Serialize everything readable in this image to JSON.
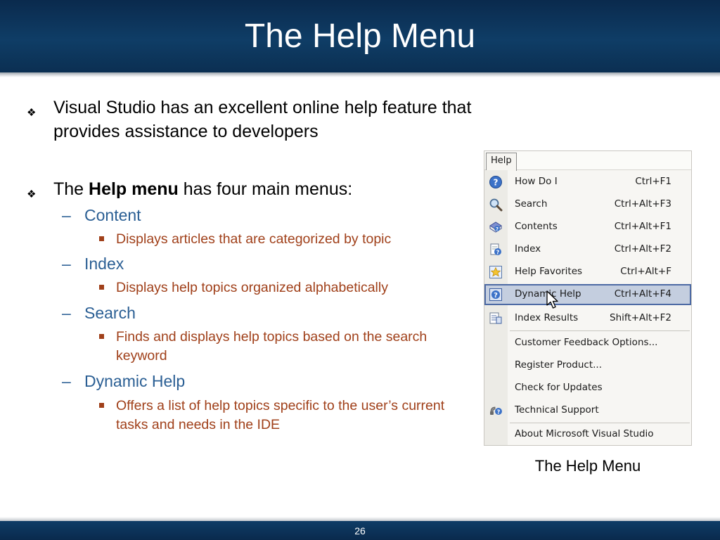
{
  "slide": {
    "title": "The Help Menu",
    "page_number": "26"
  },
  "bullets": {
    "b1_text": "Visual Studio has an excellent online help feature that provides assistance to developers",
    "b2_pre": "The ",
    "b2_bold": "Help menu",
    "b2_post": " has four main menus:",
    "sub": [
      {
        "label": "Content",
        "detail": "Displays articles that are categorized by topic"
      },
      {
        "label": "Index",
        "detail": "Displays help topics organized alphabetically"
      },
      {
        "label": "Search",
        "detail": "Finds and displays help topics based on the search keyword"
      },
      {
        "label": "Dynamic Help",
        "detail": "Offers a list of help topics specific to the user’s current tasks and needs in the IDE"
      }
    ]
  },
  "menu": {
    "tab_label": "Help",
    "items": [
      {
        "label": "How Do I",
        "shortcut": "Ctrl+F1",
        "icon": "question-circle-icon"
      },
      {
        "label": "Search",
        "shortcut": "Ctrl+Alt+F3",
        "icon": "magnifier-icon"
      },
      {
        "label": "Contents",
        "shortcut": "Ctrl+Alt+F1",
        "icon": "contents-book-icon"
      },
      {
        "label": "Index",
        "shortcut": "Ctrl+Alt+F2",
        "icon": "index-page-icon"
      },
      {
        "label": "Help Favorites",
        "shortcut": "Ctrl+Alt+F",
        "icon": "star-icon"
      },
      {
        "label": "Dynamic Help",
        "shortcut": "Ctrl+Alt+F4",
        "icon": "dynamic-help-icon",
        "selected": true
      },
      {
        "label": "Index Results",
        "shortcut": "Shift+Alt+F2",
        "icon": "index-results-icon"
      },
      {
        "label": "Customer Feedback Options...",
        "shortcut": ""
      },
      {
        "label": "Register Product...",
        "shortcut": ""
      },
      {
        "label": "Check for Updates",
        "shortcut": ""
      },
      {
        "label": "Technical Support",
        "shortcut": "",
        "icon": "technical-support-icon"
      },
      {
        "label": "About Microsoft Visual Studio",
        "shortcut": ""
      }
    ],
    "caption": "The Help Menu"
  },
  "colors": {
    "title_bar": "#0f3d66",
    "level2_text": "#2b5f94",
    "level3_text": "#a0401a",
    "menu_selection": "#c4cedf"
  }
}
